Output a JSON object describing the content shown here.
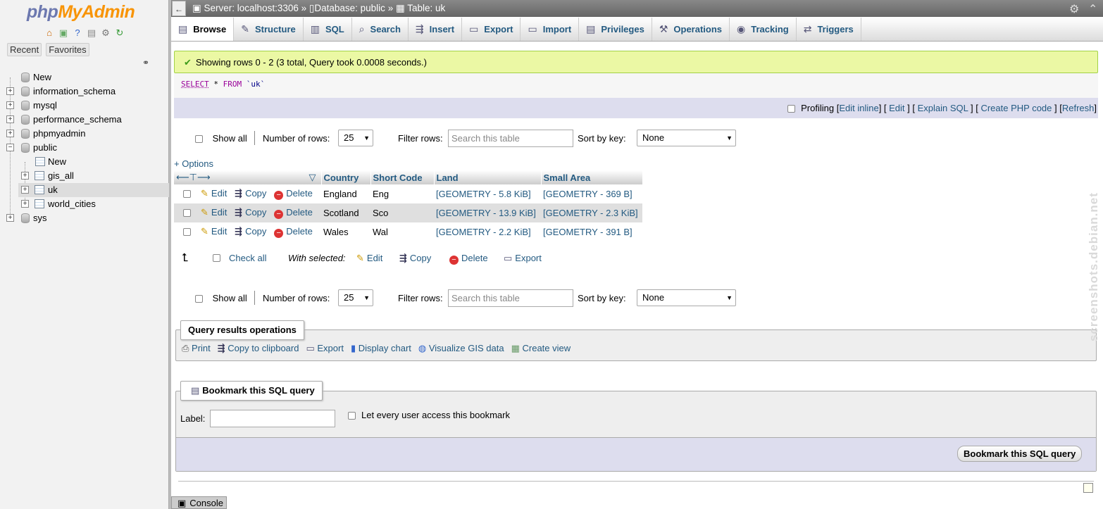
{
  "logo": {
    "p1": "php",
    "p2": "MyAdmin"
  },
  "left": {
    "tabs": [
      "Recent",
      "Favorites"
    ],
    "tree": {
      "new": "New",
      "dbs": [
        "information_schema",
        "mysql",
        "performance_schema",
        "phpmyadmin",
        "public",
        "sys"
      ],
      "public_children": {
        "new": "New",
        "tables": [
          "gis_all",
          "uk",
          "world_cities"
        ]
      }
    }
  },
  "topbar": {
    "back": "←",
    "server": "Server: localhost:3306",
    "sep": "»",
    "database": "Database: public",
    "table": "Table: uk"
  },
  "tabs": [
    "Browse",
    "Structure",
    "SQL",
    "Search",
    "Insert",
    "Export",
    "Import",
    "Privileges",
    "Operations",
    "Tracking",
    "Triggers"
  ],
  "message": "Showing rows 0 - 2 (3 total, Query took 0.0008 seconds.)",
  "sql": {
    "kw1": "SELECT",
    "rest": " * ",
    "kw2": "FROM",
    "table": "`uk`"
  },
  "profiling": {
    "label": "Profiling",
    "links": [
      "Edit inline",
      "Edit",
      "Explain SQL",
      "Create PHP code",
      "Refresh"
    ]
  },
  "nav": {
    "show_all": "Show all",
    "num_rows_label": "Number of rows:",
    "num_rows": "25",
    "filter_label": "Filter rows:",
    "filter_placeholder": "Search this table",
    "sort_label": "Sort by key:",
    "sort_value": "None"
  },
  "options_link": "+ Options",
  "columns": [
    "Country",
    "Short Code",
    "Land",
    "Small Area"
  ],
  "row_actions": {
    "edit": "Edit",
    "copy": "Copy",
    "delete": "Delete"
  },
  "rows": [
    {
      "country": "England",
      "code": "Eng",
      "land": "[GEOMETRY - 5.8 KiB]",
      "area": "[GEOMETRY - 369 B]"
    },
    {
      "country": "Scotland",
      "code": "Sco",
      "land": "[GEOMETRY - 13.9 KiB]",
      "area": "[GEOMETRY - 2.3 KiB]"
    },
    {
      "country": "Wales",
      "code": "Wal",
      "land": "[GEOMETRY - 2.2 KiB]",
      "area": "[GEOMETRY - 391 B]"
    }
  ],
  "bulk": {
    "check_all": "Check all",
    "with_selected": "With selected:",
    "edit": "Edit",
    "copy": "Copy",
    "delete": "Delete",
    "export": "Export"
  },
  "query_ops": {
    "title": "Query results operations",
    "items": [
      "Print",
      "Copy to clipboard",
      "Export",
      "Display chart",
      "Visualize GIS data",
      "Create view"
    ]
  },
  "bookmark": {
    "title": "Bookmark this SQL query",
    "label": "Label:",
    "let_every": "Let every user access this bookmark",
    "button": "Bookmark this SQL query"
  },
  "console": "Console",
  "watermark": "screenshots.debian.net",
  "colors": {
    "success_bg": "#ebf8a4",
    "link": "#235a81",
    "topbar": "#777777"
  }
}
